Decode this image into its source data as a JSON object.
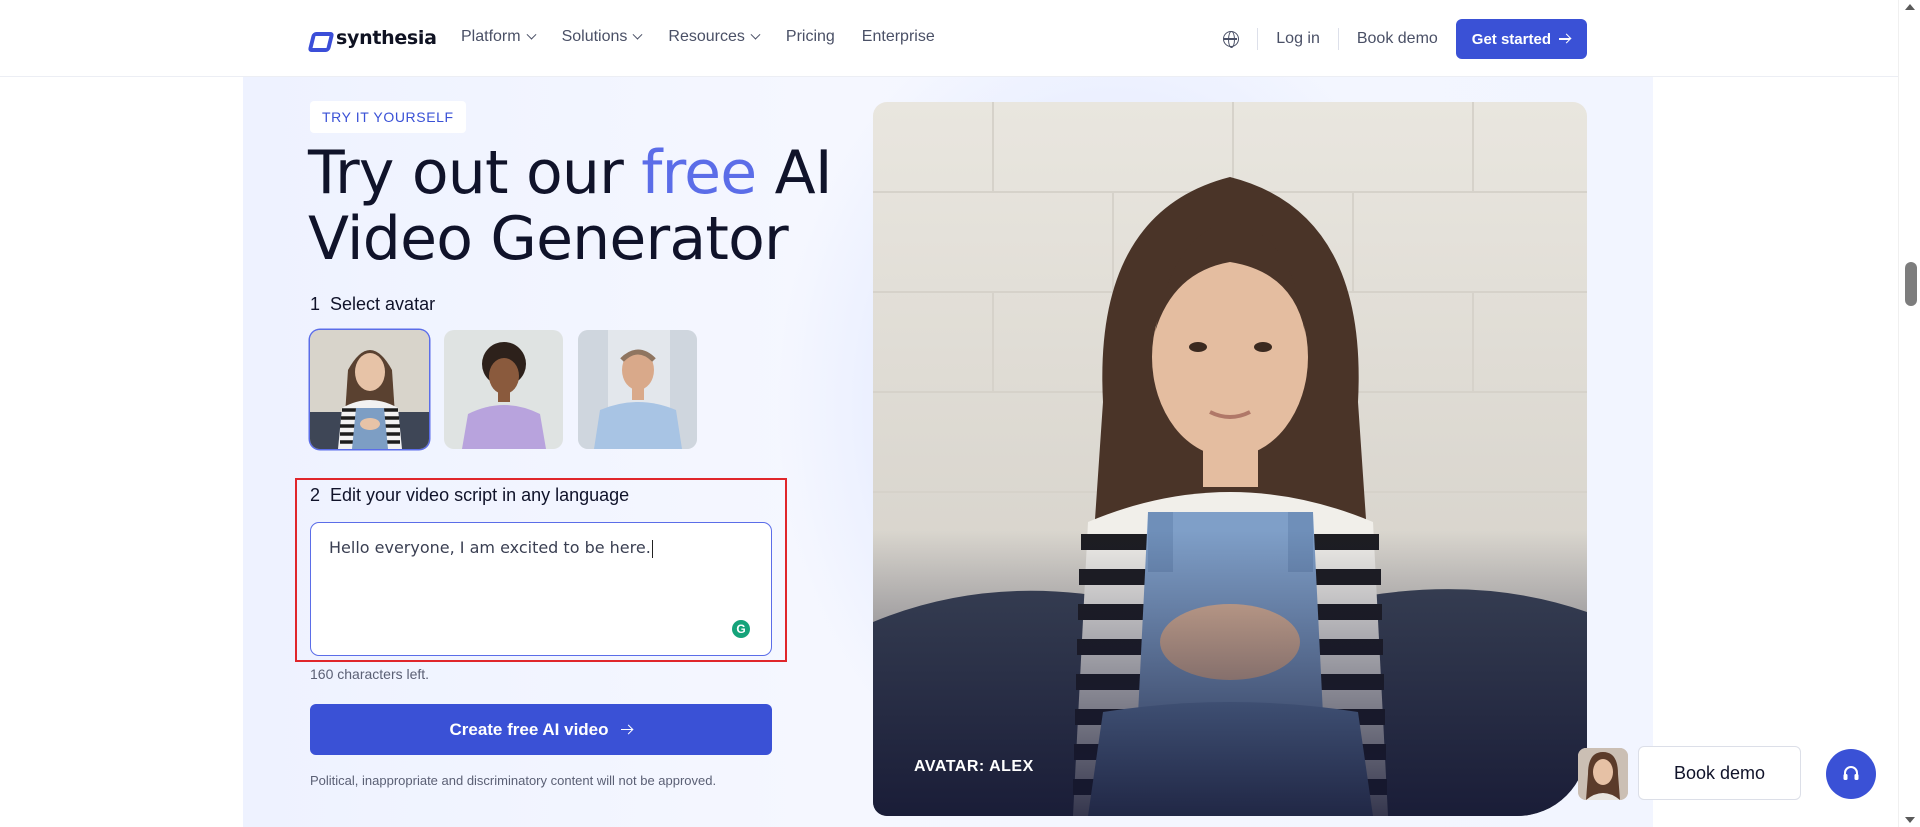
{
  "header": {
    "logo_text": "synthesia",
    "nav": [
      {
        "label": "Platform",
        "has_dropdown": true
      },
      {
        "label": "Solutions",
        "has_dropdown": true
      },
      {
        "label": "Resources",
        "has_dropdown": true
      },
      {
        "label": "Pricing",
        "has_dropdown": false
      },
      {
        "label": "Enterprise",
        "has_dropdown": false
      }
    ],
    "login_label": "Log in",
    "book_demo_label": "Book demo",
    "get_started_label": "Get started",
    "icons": {
      "language": "globe-icon",
      "arrow": "arrow-right-icon"
    }
  },
  "hero": {
    "badge": "TRY IT YOURSELF",
    "title_part1": "Try out our ",
    "title_accent": "free",
    "title_part2": " AI",
    "title_line2": "Video Generator",
    "step1_num": "1",
    "step1_label": "Select avatar",
    "avatars": [
      {
        "name": "Alex",
        "selected": true
      },
      {
        "name": "avatar-2",
        "selected": false
      },
      {
        "name": "avatar-3",
        "selected": false
      }
    ],
    "step2_num": "2",
    "step2_label": "Edit your video script in any language",
    "script_value": "Hello everyone, I am excited to be here.",
    "chars_left": "160 characters left.",
    "create_label": "Create free AI video",
    "disclaimer": "Political, inappropriate and discriminatory content will not be approved."
  },
  "video": {
    "caption": "AVATAR: ALEX"
  },
  "floating": {
    "book_demo_label": "Book demo",
    "support_icon": "headset-icon"
  },
  "colors": {
    "brand": "#3a51d6",
    "accent": "#5b6de8",
    "highlight": "#e0262b",
    "text": "#10132a"
  }
}
